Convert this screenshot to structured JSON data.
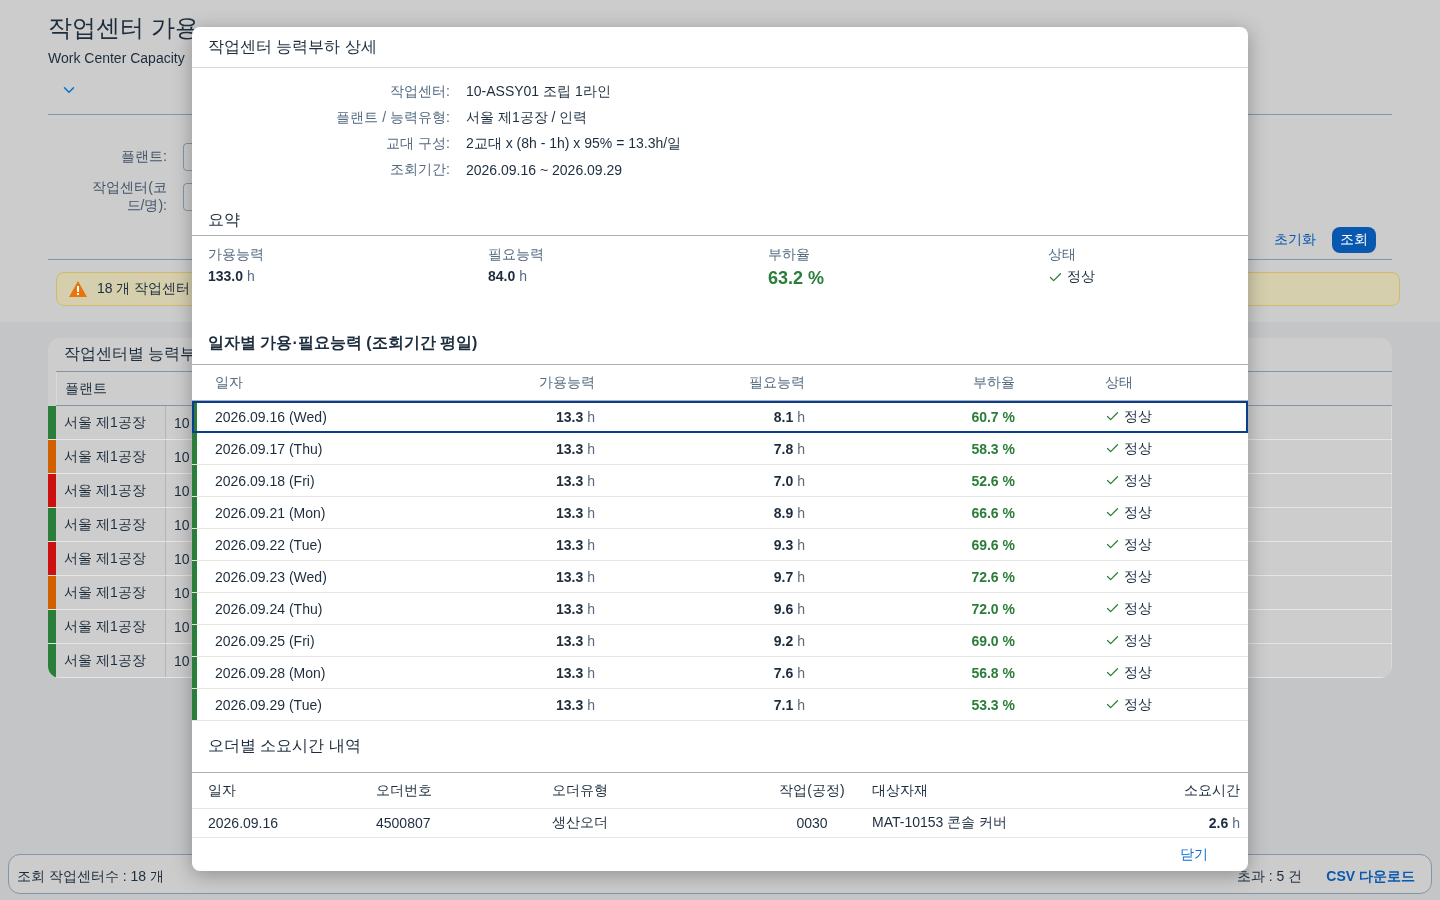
{
  "page": {
    "title": "작업센터 가용",
    "subtitle": "Work Center Capacity"
  },
  "filters": [
    {
      "label": "플랜트:"
    },
    {
      "label": "작업센터(코드/명):"
    }
  ],
  "filter_buttons": [
    {
      "label": "초기화",
      "kind": "secondary"
    },
    {
      "label": "조회",
      "kind": "primary"
    }
  ],
  "warning": {
    "text": "18 개 작업센터"
  },
  "table": {
    "title": "작업센터별 능력부",
    "columns": [
      "플랜트"
    ],
    "rows": [
      {
        "plant": "서울 제1공장",
        "code": "10",
        "color": "#2b7d3a"
      },
      {
        "plant": "서울 제1공장",
        "code": "10",
        "color": "#d06000"
      },
      {
        "plant": "서울 제1공장",
        "code": "10",
        "color": "#cc1010"
      },
      {
        "plant": "서울 제1공장",
        "code": "10",
        "color": "#2b7d3a"
      },
      {
        "plant": "서울 제1공장",
        "code": "10",
        "color": "#cc1010"
      },
      {
        "plant": "서울 제1공장",
        "code": "10",
        "color": "#d06000"
      },
      {
        "plant": "서울 제1공장",
        "code": "10",
        "color": "#2b7d3a"
      },
      {
        "plant": "서울 제1공장",
        "code": "10",
        "color": "#2b7d3a"
      }
    ]
  },
  "status_bar": {
    "count": "조회 작업센터수 : 18 개",
    "over": "초과 : 5 건",
    "download": "CSV 다운로드"
  },
  "dialog": {
    "title": "작업센터 능력부하 상세",
    "info": [
      {
        "label": "작업센터:",
        "value": "10-ASSY01 조립 1라인"
      },
      {
        "label": "플랜트 / 능력유형:",
        "value": "서울 제1공장 / 인력"
      },
      {
        "label": "교대 구성:",
        "value": "2교대 x (8h - 1h) x 95% = 13.3h/일"
      },
      {
        "label": "조회기간:",
        "value": "2026.09.16 ~ 2026.09.29"
      }
    ],
    "summary_title": "요약",
    "summary": [
      {
        "kind": "hours",
        "label": "가용능력",
        "value": "133.0",
        "unit": "h"
      },
      {
        "kind": "hours",
        "label": "필요능력",
        "value": "84.0",
        "unit": "h"
      },
      {
        "kind": "rate",
        "label": "부하율",
        "value": "63.2 %",
        "color": "#2b7d3a"
      },
      {
        "kind": "status",
        "label": "상태",
        "value": "정상",
        "color": "#2b7d3a"
      }
    ],
    "daily_title": "일자별 가용·필요능력 (조회기간 평일)",
    "daily_columns": [
      "일자",
      "가용능력",
      "필요능력",
      "부하율",
      "상태"
    ],
    "daily": [
      {
        "date": "2026.09.16 (Wed)",
        "available": "13.3",
        "available_unit": "h",
        "required": "8.1",
        "required_unit": "h",
        "rate": "60.7 %",
        "status": "정상",
        "color": "#2b7d3a",
        "selected": true
      },
      {
        "date": "2026.09.17 (Thu)",
        "available": "13.3",
        "available_unit": "h",
        "required": "7.8",
        "required_unit": "h",
        "rate": "58.3 %",
        "status": "정상",
        "color": "#2b7d3a",
        "selected": false
      },
      {
        "date": "2026.09.18 (Fri)",
        "available": "13.3",
        "available_unit": "h",
        "required": "7.0",
        "required_unit": "h",
        "rate": "52.6 %",
        "status": "정상",
        "color": "#2b7d3a",
        "selected": false
      },
      {
        "date": "2026.09.21 (Mon)",
        "available": "13.3",
        "available_unit": "h",
        "required": "8.9",
        "required_unit": "h",
        "rate": "66.6 %",
        "status": "정상",
        "color": "#2b7d3a",
        "selected": false
      },
      {
        "date": "2026.09.22 (Tue)",
        "available": "13.3",
        "available_unit": "h",
        "required": "9.3",
        "required_unit": "h",
        "rate": "69.6 %",
        "status": "정상",
        "color": "#2b7d3a",
        "selected": false
      },
      {
        "date": "2026.09.23 (Wed)",
        "available": "13.3",
        "available_unit": "h",
        "required": "9.7",
        "required_unit": "h",
        "rate": "72.6 %",
        "status": "정상",
        "color": "#2b7d3a",
        "selected": false
      },
      {
        "date": "2026.09.24 (Thu)",
        "available": "13.3",
        "available_unit": "h",
        "required": "9.6",
        "required_unit": "h",
        "rate": "72.0 %",
        "status": "정상",
        "color": "#2b7d3a",
        "selected": false
      },
      {
        "date": "2026.09.25 (Fri)",
        "available": "13.3",
        "available_unit": "h",
        "required": "9.2",
        "required_unit": "h",
        "rate": "69.0 %",
        "status": "정상",
        "color": "#2b7d3a",
        "selected": false
      },
      {
        "date": "2026.09.28 (Mon)",
        "available": "13.3",
        "available_unit": "h",
        "required": "7.6",
        "required_unit": "h",
        "rate": "56.8 %",
        "status": "정상",
        "color": "#2b7d3a",
        "selected": false
      },
      {
        "date": "2026.09.29 (Tue)",
        "available": "13.3",
        "available_unit": "h",
        "required": "7.1",
        "required_unit": "h",
        "rate": "53.3 %",
        "status": "정상",
        "color": "#2b7d3a",
        "selected": false
      }
    ],
    "orders_title": "오더별 소요시간 내역",
    "order_columns": [
      "일자",
      "오더번호",
      "오더유형",
      "작업(공정)",
      "대상자재",
      "소요시간"
    ],
    "orders": [
      {
        "date": "2026.09.16",
        "order": "4500807",
        "type": "생산오더",
        "operation": "0030",
        "material": "MAT-10153 콘솔 커버",
        "hours": "2.6",
        "unit": "h"
      }
    ],
    "close": "닫기"
  }
}
